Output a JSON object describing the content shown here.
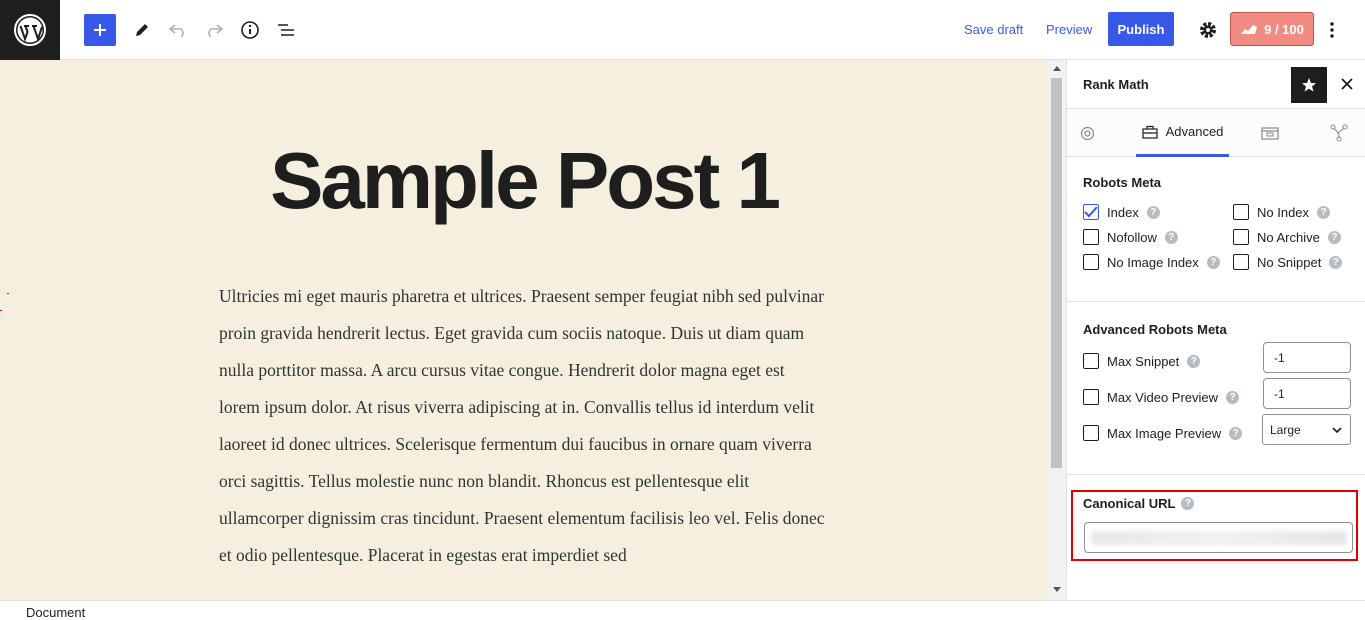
{
  "toolbar": {
    "save_draft": "Save draft",
    "preview": "Preview",
    "publish": "Publish",
    "seo_score": "9 / 100",
    "icons": [
      "wordpress-icon",
      "plus-icon",
      "pencil-icon",
      "undo-icon",
      "redo-icon",
      "info-icon",
      "list-view-icon",
      "gear-icon",
      "rank-math-icon",
      "more-vertical-icon"
    ]
  },
  "editor": {
    "title": "Sample Post 1",
    "body": "Ultricies mi eget mauris pharetra et ultrices. Praesent semper feugiat nibh sed pulvinar proin gravida hendrerit lectus. Eget gravida cum sociis natoque. Duis ut diam quam nulla porttitor massa. A arcu cursus vitae congue. Hendrerit dolor magna eget est lorem ipsum dolor. At risus viverra adipiscing at in. Convallis tellus id interdum velit laoreet id donec ultrices. Scelerisque fermentum dui faucibus in ornare quam viverra orci sagittis. Tellus molestie nunc non blandit. Rhoncus est pellentesque elit ullamcorper dignissim cras tincidunt. Praesent elementum facilisis leo vel. Felis donec et odio pellentesque. Placerat in egestas erat imperdiet sed"
  },
  "sidebar": {
    "title": "Rank Math",
    "active_tab": "Advanced",
    "robots_meta": {
      "title": "Robots Meta",
      "options": [
        {
          "label": "Index",
          "checked": true
        },
        {
          "label": "No Index",
          "checked": false
        },
        {
          "label": "Nofollow",
          "checked": false
        },
        {
          "label": "No Archive",
          "checked": false
        },
        {
          "label": "No Image Index",
          "checked": false
        },
        {
          "label": "No Snippet",
          "checked": false
        }
      ]
    },
    "advanced_robots": {
      "title": "Advanced Robots Meta",
      "max_snippet": {
        "label": "Max Snippet",
        "value": "-1"
      },
      "max_video_preview": {
        "label": "Max Video Preview",
        "value": "-1"
      },
      "max_image_preview": {
        "label": "Max Image Preview",
        "value": "Large"
      }
    },
    "canonical": {
      "title": "Canonical URL",
      "value": ""
    }
  },
  "footer": {
    "breadcrumb": "Document"
  },
  "colors": {
    "accent": "#3858e9",
    "canvas_bg": "#f5efe0",
    "score_bg": "#f28b82",
    "highlight": "#e00000"
  }
}
